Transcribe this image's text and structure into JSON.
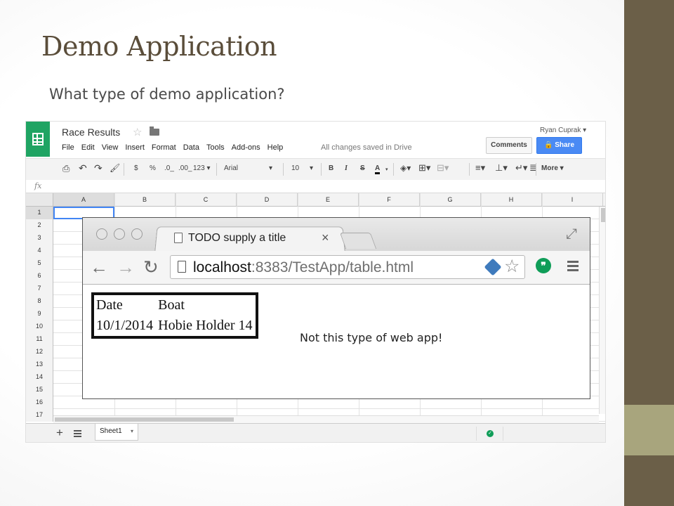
{
  "slide": {
    "title": "Demo Application",
    "subtitle": "What type of demo application?",
    "colors": {
      "title": "#5a4d3a",
      "sidebar": "#6b5f48",
      "sidebar_accent": "#a8a57d"
    }
  },
  "spreadsheet": {
    "doc_title": "Race Results",
    "user": "Ryan Cuprak",
    "menu": [
      "File",
      "Edit",
      "View",
      "Insert",
      "Format",
      "Data",
      "Tools",
      "Add-ons",
      "Help"
    ],
    "saved_status": "All changes saved in Drive",
    "comments_label": "Comments",
    "share_label": "Share",
    "toolbar": {
      "currency": "$",
      "percent": "%",
      "dec_decrease": ".0_",
      "dec_increase": ".00_",
      "number_format": "123",
      "font": "Arial",
      "font_size": "10",
      "bold": "B",
      "italic": "I",
      "strike": "S",
      "text_color": "A",
      "more": "More"
    },
    "fx_label": "fx",
    "columns": [
      "A",
      "B",
      "C",
      "D",
      "E",
      "F",
      "G",
      "H",
      "I"
    ],
    "rows": [
      "1",
      "2",
      "3",
      "4",
      "5",
      "6",
      "7",
      "8",
      "9",
      "10",
      "11",
      "12",
      "13",
      "14",
      "15",
      "16",
      "17"
    ],
    "sheet_tab": "Sheet1",
    "accent_color": "#1fa463",
    "share_color": "#4a8af4"
  },
  "browser": {
    "tab_title": "TODO supply a title",
    "url_host": "localhost",
    "url_rest": ":8383/TestApp/table.html",
    "table": {
      "headers": [
        "Date",
        "Boat"
      ],
      "rows": [
        [
          "10/1/2014",
          "Hobie Holder 14"
        ]
      ]
    }
  },
  "note": "Not this type of web app!"
}
